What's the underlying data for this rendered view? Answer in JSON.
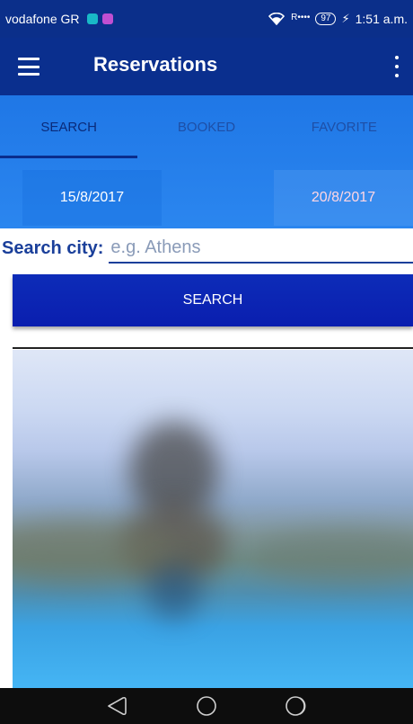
{
  "status_bar": {
    "carrier": "vodafone GR",
    "signal": "R••••",
    "battery": "97",
    "time": "1:51 a.m."
  },
  "app_bar": {
    "title": "Reservations"
  },
  "tabs": [
    {
      "label": "SEARCH",
      "active": true
    },
    {
      "label": "BOOKED",
      "active": false
    },
    {
      "label": "FAVORITE",
      "active": false
    }
  ],
  "dates": {
    "start": "15/8/2017",
    "end": "20/8/2017"
  },
  "search": {
    "label": "Search city:",
    "placeholder": "e.g. Athens",
    "value": "",
    "button_label": "SEARCH"
  },
  "icons": {
    "menu": "menu-icon",
    "more": "more-vert-icon",
    "wifi": "wifi-icon",
    "battery": "battery-icon",
    "charging": "bolt-icon",
    "nav_back": "back-triangle-icon",
    "nav_home": "home-circle-icon",
    "nav_recent": "recent-apps-icon"
  },
  "colors": {
    "app_bar": "#0a2f8e",
    "tab_panel": "#2b86ef",
    "search_button": "#0d2cb8",
    "label": "#1a3f9a"
  }
}
